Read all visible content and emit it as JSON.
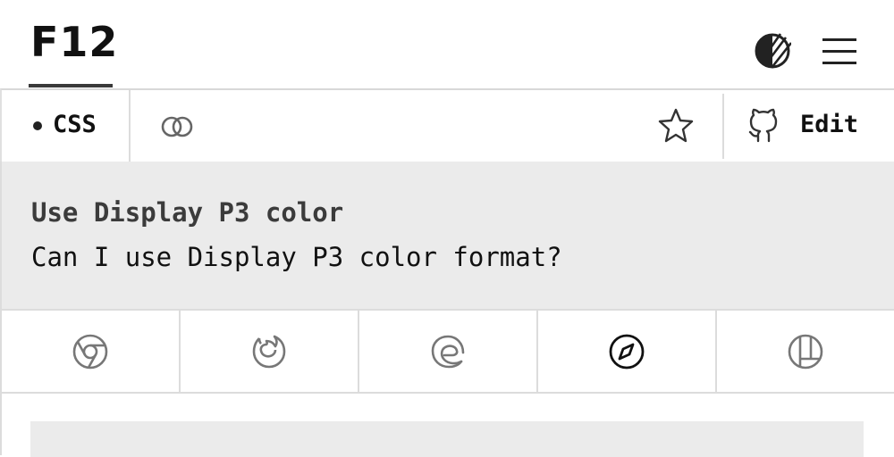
{
  "header": {
    "logo": "F12",
    "theme_icon": "half-circle-theme-icon",
    "menu_icon": "hamburger-menu-icon"
  },
  "toolbar": {
    "category_label": "CSS",
    "link_icon": "link-icon",
    "star_icon": "star-icon",
    "github_icon": "github-icon",
    "edit_label": "Edit"
  },
  "feature": {
    "title": "Use Display P3 color",
    "description": "Can I use Display P3 color format?"
  },
  "browsers": [
    {
      "name": "chrome-icon",
      "active": false
    },
    {
      "name": "firefox-icon",
      "active": false
    },
    {
      "name": "edge-icon",
      "active": false
    },
    {
      "name": "safari-icon",
      "active": true
    },
    {
      "name": "other-browser-icon",
      "active": false
    }
  ],
  "colors": {
    "active": "#111111",
    "inactive": "#777777",
    "panel_bg": "#ebebeb",
    "border": "#dcdcdc"
  }
}
